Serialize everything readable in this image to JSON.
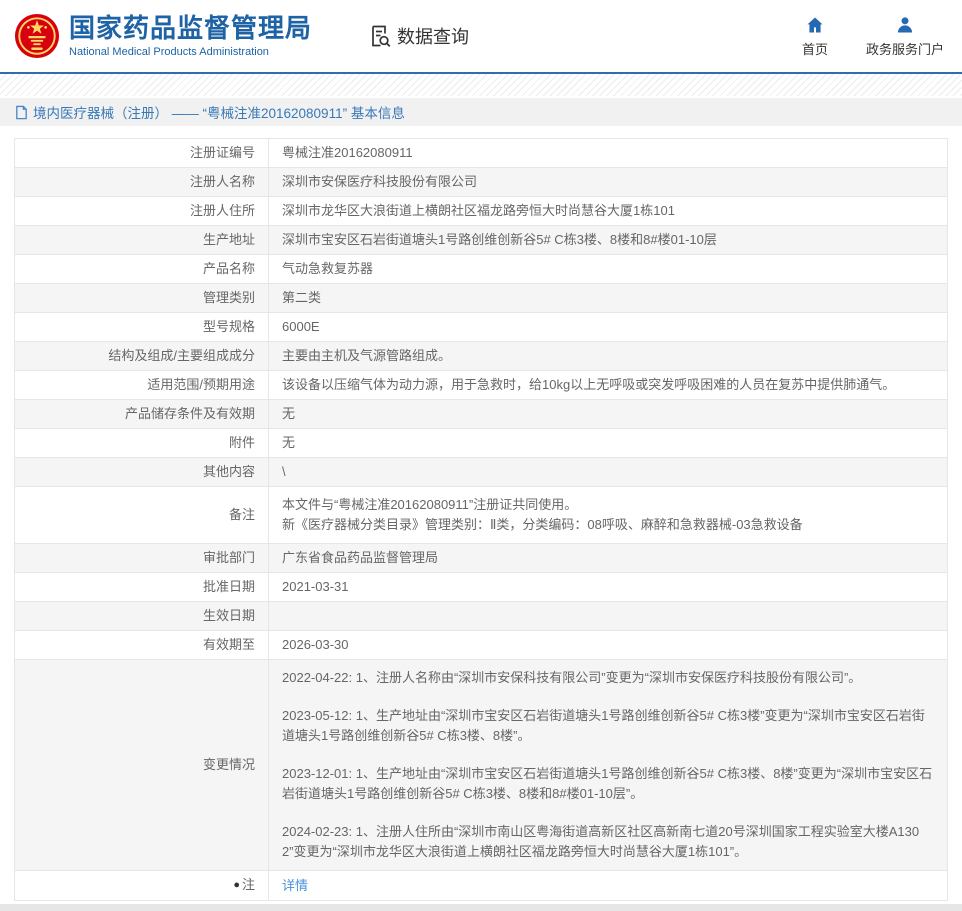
{
  "colors": {
    "brand_blue": "#1e63a5",
    "icon_blue": "#2569b3",
    "title_blue": "#3779b8",
    "link_blue": "#4a90d9",
    "emblem_red": "#d7000f",
    "row_alt_gray": "#f5f5f5"
  },
  "header": {
    "org_name_cn": "国家药品监督管理局",
    "org_name_en": "National Medical Products Administration",
    "section_title": "数据查询",
    "nav": [
      {
        "label": "首页",
        "icon": "home-icon"
      },
      {
        "label": "政务服务门户",
        "icon": "user-icon"
      }
    ]
  },
  "page_title": "境内医疗器械（注册） —— “粤械注准20162080911” 基本信息",
  "table": {
    "rows": [
      {
        "label": "注册证编号",
        "value": "粤械注准20162080911"
      },
      {
        "label": "注册人名称",
        "value": "深圳市安保医疗科技股份有限公司"
      },
      {
        "label": "注册人住所",
        "value": "深圳市龙华区大浪街道上横朗社区福龙路旁恒大时尚慧谷大厦1栋101"
      },
      {
        "label": "生产地址",
        "value": "深圳市宝安区石岩街道塘头1号路创维创新谷5# C栋3楼、8楼和8#楼01-10层"
      },
      {
        "label": "产品名称",
        "value": "气动急救复苏器"
      },
      {
        "label": "管理类别",
        "value": "第二类"
      },
      {
        "label": "型号规格",
        "value": "6000E"
      },
      {
        "label": "结构及组成/主要组成成分",
        "value": "主要由主机及气源管路组成。"
      },
      {
        "label": "适用范围/预期用途",
        "value": "该设备以压缩气体为动力源，用于急救时，给10kg以上无呼吸或突发呼吸困难的人员在复苏中提供肺通气。"
      },
      {
        "label": "产品储存条件及有效期",
        "value": "无"
      },
      {
        "label": "附件",
        "value": "无"
      },
      {
        "label": "其他内容",
        "value": "\\"
      },
      {
        "label": "备注",
        "lines": [
          "本文件与“粤械注准20162080911”注册证共同使用。",
          "新《医疗器械分类目录》管理类别：Ⅱ类，分类编码：08呼吸、麻醉和急救器械-03急救设备"
        ]
      },
      {
        "label": "审批部门",
        "value": "广东省食品药品监督管理局"
      },
      {
        "label": "批准日期",
        "value": "2021-03-31"
      },
      {
        "label": "生效日期",
        "value": ""
      },
      {
        "label": "有效期至",
        "value": "2026-03-30"
      },
      {
        "label": "变更情况",
        "paragraphs": [
          "2022-04-22: 1、注册人名称由“深圳市安保科技有限公司”变更为“深圳市安保医疗科技股份有限公司”。",
          "2023-05-12: 1、生产地址由“深圳市宝安区石岩街道塘头1号路创维创新谷5# C栋3楼”变更为“深圳市宝安区石岩街道塘头1号路创维创新谷5# C栋3楼、8楼”。",
          "2023-12-01: 1、生产地址由“深圳市宝安区石岩街道塘头1号路创维创新谷5# C栋3楼、8楼”变更为“深圳市宝安区石岩街道塘头1号路创维创新谷5# C栋3楼、8楼和8#楼01-10层”。",
          "2024-02-23: 1、注册人住所由“深圳市南山区粤海街道高新区社区高新南七道20号深圳国家工程实验室大楼A1302”变更为“深圳市龙华区大浪街道上横朗社区福龙路旁恒大时尚慧谷大厦1栋101”。"
        ]
      },
      {
        "label": "注",
        "label_icon": "note-icon",
        "link": "详情"
      }
    ]
  }
}
